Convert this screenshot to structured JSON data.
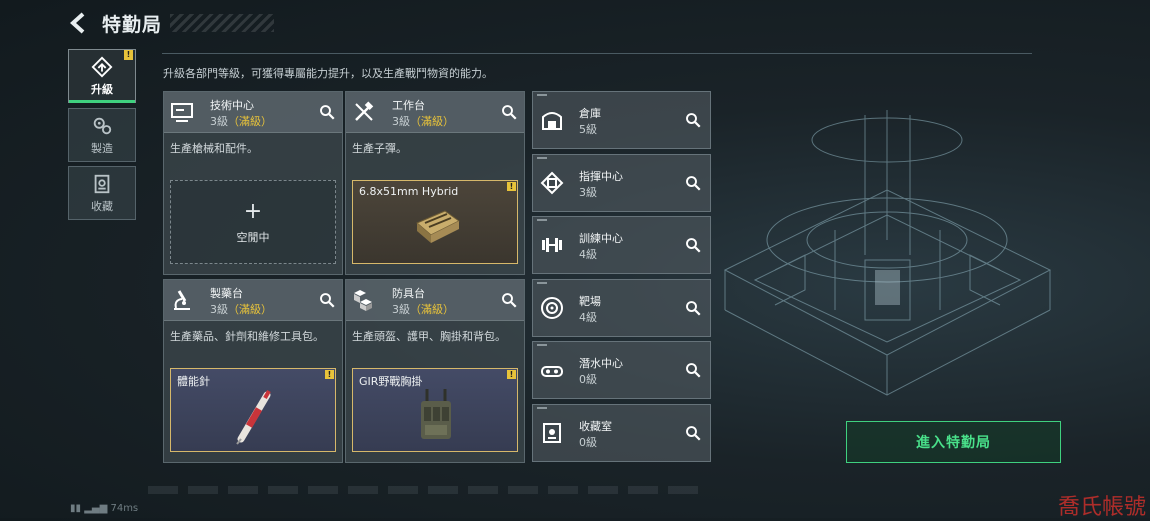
{
  "header": {
    "title": "特勤局"
  },
  "description": "升級各部門等級，可獲得專屬能力提升，以及生產戰鬥物資的能力。",
  "side_tabs": [
    {
      "label": "升級",
      "badge": "!"
    },
    {
      "label": "製造"
    },
    {
      "label": "收藏"
    }
  ],
  "cards": [
    {
      "name": "技術中心",
      "level": "3級",
      "max": "（滿級）",
      "desc": "生產槍械和配件。",
      "slot": {
        "state": "empty",
        "plus": "+",
        "label": "空閒中"
      }
    },
    {
      "name": "工作台",
      "level": "3級",
      "max": "（滿級）",
      "desc": "生產子彈。",
      "slot": {
        "state": "item",
        "label": "6.8x51mm Hybrid",
        "badge": "!"
      }
    },
    {
      "name": "製藥台",
      "level": "3級",
      "max": "（滿級）",
      "desc": "生產藥品、針劑和維修工具包。",
      "slot": {
        "state": "item",
        "label": "體能針",
        "badge": "!"
      }
    },
    {
      "name": "防具台",
      "level": "3級",
      "max": "（滿級）",
      "desc": "生產頭盔、護甲、胸掛和背包。",
      "slot": {
        "state": "item",
        "label": "GIR野戰胸掛",
        "badge": "!"
      }
    }
  ],
  "facilities": [
    {
      "name": "倉庫",
      "level": "5級"
    },
    {
      "name": "指揮中心",
      "level": "3級"
    },
    {
      "name": "訓練中心",
      "level": "4級"
    },
    {
      "name": "靶場",
      "level": "4級"
    },
    {
      "name": "潛水中心",
      "level": "0級"
    },
    {
      "name": "收藏室",
      "level": "0級"
    }
  ],
  "enter_button": "進入特勤局",
  "status": {
    "ping": "74ms"
  },
  "watermark": "喬氏帳號",
  "colors": {
    "accent_green": "#3fd17f",
    "max_yellow": "#e8c33a",
    "slot_border": "#d6b86a"
  }
}
